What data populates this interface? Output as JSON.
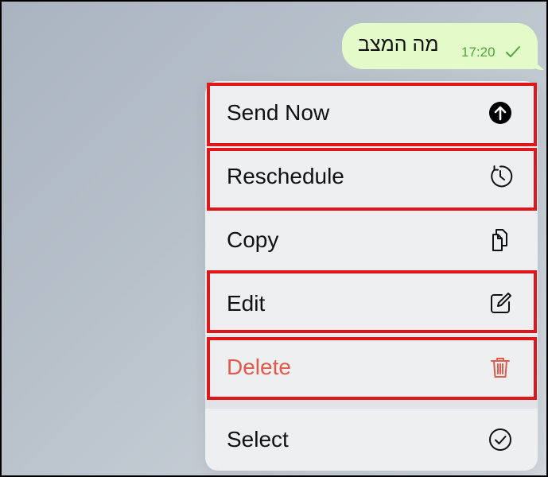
{
  "message": {
    "text": "מה המצב",
    "time": "17:20",
    "status_icon": "check-icon"
  },
  "menu": {
    "items": [
      {
        "label": "Send Now",
        "icon": "arrow-up-circle-icon",
        "color": "#111111",
        "highlighted": true
      },
      {
        "label": "Reschedule",
        "icon": "clock-refresh-icon",
        "color": "#111111",
        "highlighted": true
      },
      {
        "label": "Copy",
        "icon": "copy-icon",
        "color": "#111111",
        "highlighted": false
      },
      {
        "label": "Edit",
        "icon": "edit-icon",
        "color": "#111111",
        "highlighted": true
      },
      {
        "label": "Delete",
        "icon": "trash-icon",
        "color": "#e25a4b",
        "highlighted": true
      },
      {
        "label": "Select",
        "icon": "check-circle-icon",
        "color": "#111111",
        "highlighted": false
      }
    ]
  },
  "colors": {
    "bubble": "#e2fbc9",
    "time": "#52a53a",
    "delete": "#e25a4b",
    "highlight": "#e0161b"
  }
}
